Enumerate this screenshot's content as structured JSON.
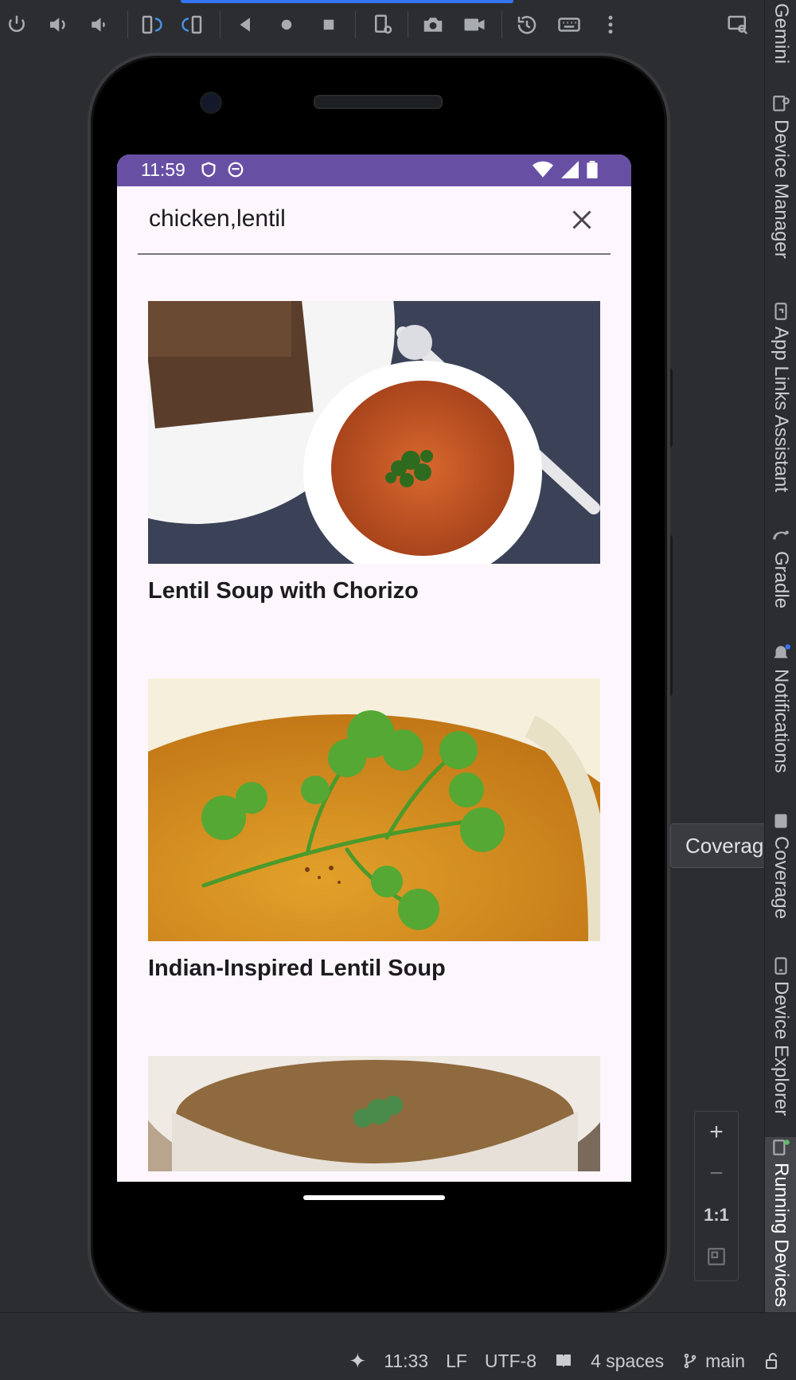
{
  "toolbar": {
    "icons": [
      "power-icon",
      "volume-up-icon",
      "volume-down-icon",
      "rotate-left-icon",
      "rotate-right-icon",
      "back-icon",
      "home-icon",
      "overview-icon",
      "device-settings-icon",
      "camera-icon",
      "record-icon",
      "snapshot-icon",
      "keyboard-icon",
      "more-icon",
      "mirror-icon"
    ]
  },
  "right_strip": {
    "items": [
      {
        "label": "Gemini"
      },
      {
        "label": "Device Manager"
      },
      {
        "label": "App Links Assistant"
      },
      {
        "label": "Gradle"
      },
      {
        "label": "Notifications"
      },
      {
        "label": "Coverage"
      },
      {
        "label": "Device Explorer"
      },
      {
        "label": "Running Devices"
      }
    ]
  },
  "tooltip": {
    "text": "Coverage"
  },
  "device": {
    "status_time": "11:59",
    "search": {
      "value": "chicken,lentil"
    },
    "recipes": [
      {
        "title": "Lentil Soup with Chorizo"
      },
      {
        "title": "Indian-Inspired Lentil Soup"
      },
      {
        "title": ""
      }
    ]
  },
  "zoom": {
    "plus": "+",
    "minus": "−",
    "one_to_one": "1:1"
  },
  "status_bar": {
    "time": "11:33",
    "line_sep": "LF",
    "encoding": "UTF-8",
    "indent": "4 spaces",
    "branch": "main"
  },
  "colors": {
    "accent": "#6750a4",
    "ide_bg": "#2b2d30",
    "screen_bg": "#fdf7fd"
  }
}
